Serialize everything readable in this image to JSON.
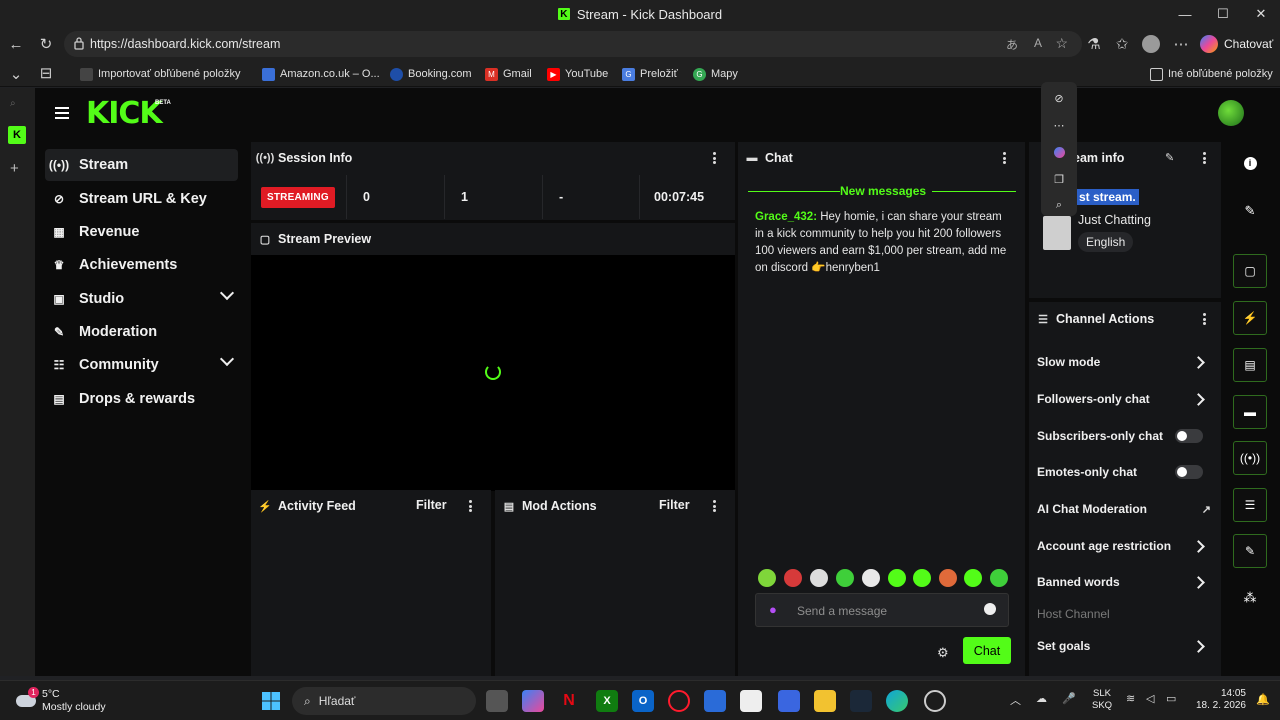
{
  "window": {
    "title": "Stream - Kick Dashboard",
    "minimize": "—",
    "maximize": "☐",
    "close": "✕"
  },
  "browser": {
    "url": "https://dashboard.kick.com/stream",
    "chat_button": "Chatovať",
    "bookmarks": [
      {
        "label": "Importovať obľúbené položky",
        "color": "#3b3b3b"
      },
      {
        "label": "Amazon.co.uk – O...",
        "color": "#3a6fd8"
      },
      {
        "label": "Booking.com",
        "color": "#1e4ea8"
      },
      {
        "label": "Gmail",
        "color": "#d93025"
      },
      {
        "label": "YouTube",
        "color": "#ff0000"
      },
      {
        "label": "Preložiť",
        "color": "#4a7de0"
      },
      {
        "label": "Mapy",
        "color": "#34a853"
      }
    ],
    "other_bookmarks": "Iné obľúbené položky"
  },
  "brand": {
    "logo": "KICK",
    "badge": "BETA",
    "accent": "#53fc18"
  },
  "sidebar": {
    "items": [
      {
        "label": "Stream",
        "icon": "broadcast-icon",
        "glyph": "((•))"
      },
      {
        "label": "Stream URL & Key",
        "icon": "link-icon",
        "glyph": "🔗"
      },
      {
        "label": "Revenue",
        "icon": "chart-icon",
        "glyph": "▦"
      },
      {
        "label": "Achievements",
        "icon": "trophy-icon",
        "glyph": "🏆"
      },
      {
        "label": "Studio",
        "icon": "camera-icon",
        "glyph": "▶"
      },
      {
        "label": "Moderation",
        "icon": "wrench-icon",
        "glyph": "🔧"
      },
      {
        "label": "Community",
        "icon": "users-icon",
        "glyph": "👥"
      },
      {
        "label": "Drops & rewards",
        "icon": "gift-icon",
        "glyph": "🎁"
      }
    ]
  },
  "session": {
    "title": "Session Info",
    "status": "STREAMING",
    "viewers": "0",
    "followers": "1",
    "subs": "-",
    "uptime": "00:07:45"
  },
  "preview": {
    "title": "Stream Preview"
  },
  "activity": {
    "title": "Activity Feed",
    "filter": "Filter"
  },
  "mod": {
    "title": "Mod Actions",
    "filter": "Filter"
  },
  "chat": {
    "title": "Chat",
    "new_messages": "New messages",
    "message": {
      "user": "Grace_432:",
      "text": " Hey homie, i can share your stream in a kick community to help you hit 200 followers 100 viewers and earn $1,000 per stream, add me on discord 👉henryben1"
    },
    "placeholder": "Send a message",
    "send": "Chat"
  },
  "stream_info": {
    "title": "eam info",
    "stream_title": "st stream.",
    "category": "Just Chatting",
    "language": "English"
  },
  "channel_actions": {
    "title": "Channel Actions",
    "items": [
      {
        "label": "Slow mode",
        "type": "arrow"
      },
      {
        "label": "Followers-only chat",
        "type": "arrow"
      },
      {
        "label": "Subscribers-only chat",
        "type": "toggle"
      },
      {
        "label": "Emotes-only chat",
        "type": "toggle"
      },
      {
        "label": "AI Chat Moderation",
        "type": "external"
      },
      {
        "label": "Account age restriction",
        "type": "arrow"
      },
      {
        "label": "Banned words",
        "type": "arrow"
      },
      {
        "label": "Host Channel",
        "type": "disabled"
      },
      {
        "label": "Set goals",
        "type": "arrow"
      }
    ]
  },
  "taskbar": {
    "weather_temp": "5°C",
    "weather_desc": "Mostly cloudy",
    "search": "Hľadať",
    "lang": "SLK",
    "lang2": "SKQ",
    "time": "14:05",
    "date": "18. 2. 2026"
  }
}
